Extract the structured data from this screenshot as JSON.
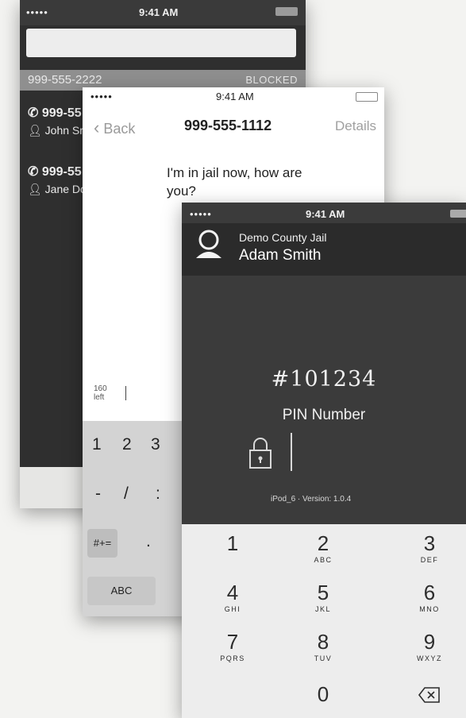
{
  "phone_back": {
    "status_time": "9:41 AM",
    "signal": "•••••",
    "blocked_number": "999-555-2222",
    "blocked_label": "BLOCKED",
    "contacts": [
      {
        "phone": "999-55",
        "name": "John Sr"
      },
      {
        "phone": "999-55",
        "name": "Jane Dc"
      }
    ]
  },
  "phone_middle": {
    "status_time": "9:41 AM",
    "signal": "•••••",
    "back_label": "Back",
    "title": "999-555-1112",
    "details_label": "Details",
    "message": "I'm in jail now, how are you?",
    "char_count": "160",
    "char_count_label": "left",
    "keys_row1": [
      "1",
      "2",
      "3"
    ],
    "keys_row2": [
      "-",
      "/",
      ":"
    ],
    "key_symbols": "#+=",
    "key_period": ".",
    "key_abc": "ABC"
  },
  "phone_front": {
    "status_time": "9:41 AM",
    "signal": "•••••",
    "facility": "Demo County Jail",
    "inmate_name": "Adam Smith",
    "pin_value": "#101234",
    "pin_label": "PIN Number",
    "version": "iPod_6 · Version: 1.0.4",
    "keypad": [
      {
        "digit": "1",
        "letters": ""
      },
      {
        "digit": "2",
        "letters": "ABC"
      },
      {
        "digit": "3",
        "letters": "DEF"
      },
      {
        "digit": "4",
        "letters": "GHI"
      },
      {
        "digit": "5",
        "letters": "JKL"
      },
      {
        "digit": "6",
        "letters": "MNO"
      },
      {
        "digit": "7",
        "letters": "PQRS"
      },
      {
        "digit": "8",
        "letters": "TUV"
      },
      {
        "digit": "9",
        "letters": "WXYZ"
      },
      {
        "digit": "0",
        "letters": ""
      }
    ],
    "icons": [
      "person-icon",
      "lock-icon",
      "backspace-icon"
    ]
  }
}
